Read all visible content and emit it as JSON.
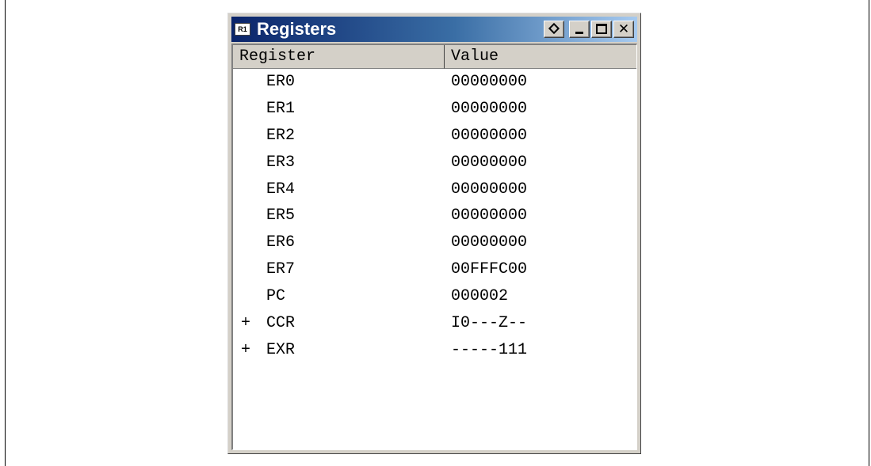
{
  "window": {
    "title": "Registers",
    "icon_label": "R1",
    "buttons": [
      "pin-icon",
      "minimize-icon",
      "maximize-icon",
      "close-icon"
    ],
    "close_glyph": "✕"
  },
  "table": {
    "columns": [
      "Register",
      "Value"
    ],
    "rows": [
      {
        "expander": "",
        "name": "ER0",
        "value": "00000000"
      },
      {
        "expander": "",
        "name": "ER1",
        "value": "00000000"
      },
      {
        "expander": "",
        "name": "ER2",
        "value": "00000000"
      },
      {
        "expander": "",
        "name": "ER3",
        "value": "00000000"
      },
      {
        "expander": "",
        "name": "ER4",
        "value": "00000000"
      },
      {
        "expander": "",
        "name": "ER5",
        "value": "00000000"
      },
      {
        "expander": "",
        "name": "ER6",
        "value": "00000000"
      },
      {
        "expander": "",
        "name": "ER7",
        "value": "00FFFC00"
      },
      {
        "expander": "",
        "name": "PC",
        "value": "000002"
      },
      {
        "expander": "+",
        "name": "CCR",
        "value": "I0---Z--"
      },
      {
        "expander": "+",
        "name": "EXR",
        "value": "-----111"
      }
    ]
  },
  "colors": {
    "titlebar_start": "#0a246a",
    "titlebar_end": "#a6caf0",
    "window_face": "#d4d0c8"
  }
}
